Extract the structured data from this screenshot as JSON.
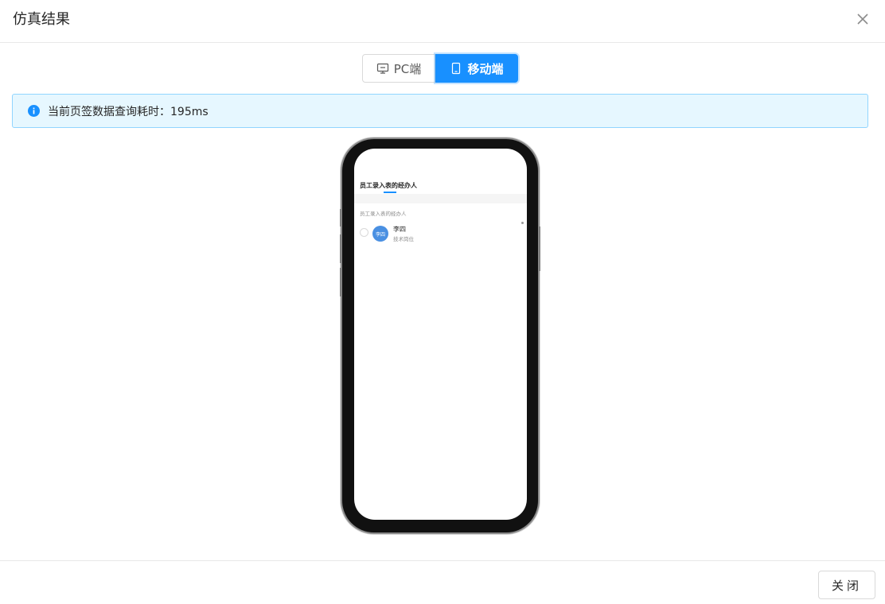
{
  "dialog": {
    "title": "仿真结果"
  },
  "segmented": {
    "pc_label": "PC端",
    "mobile_label": "移动端",
    "selected": "mobile"
  },
  "alert": {
    "text": "当前页签数据查询耗时：195ms"
  },
  "phone_screen": {
    "tab_title": "员工录入表的经办人",
    "section_label": "员工录入表的经办人",
    "person": {
      "avatar_text": "李四",
      "name": "李四",
      "role": "技术岗位"
    }
  },
  "footer": {
    "close_label": "关闭"
  },
  "colors": {
    "primary": "#1890ff",
    "alert_bg": "#e6f7ff",
    "alert_border": "#91d5ff"
  }
}
